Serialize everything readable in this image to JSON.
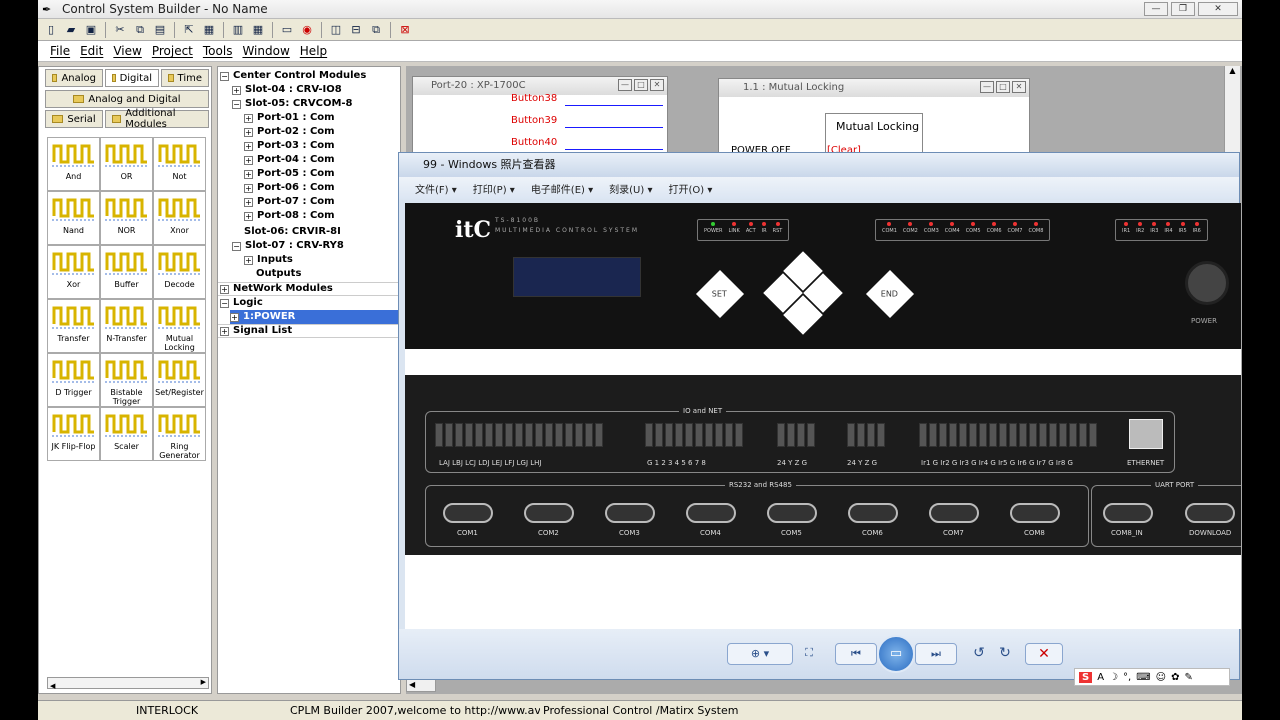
{
  "app": {
    "title": "Control System Builder - No Name",
    "menu": [
      "File",
      "Edit",
      "View",
      "Project",
      "Tools",
      "Window",
      "Help"
    ]
  },
  "left_panel": {
    "tabs_row1": [
      "Analog",
      "Digital",
      "Time"
    ],
    "tab_row2": "Analog and Digital",
    "tabs_row3": [
      "Serial",
      "Additional Modules"
    ],
    "modules": [
      "And",
      "OR",
      "Not",
      "Nand",
      "NOR",
      "Xnor",
      "Xor",
      "Buffer",
      "Decode",
      "Transfer",
      "N-Transfer",
      "Mutual Locking",
      "D Trigger",
      "Bistable Trigger",
      "Set/Register",
      "JK Flip-Flop",
      "Scaler",
      "Ring Generator"
    ]
  },
  "tree": {
    "center_control": "Center Control Modules",
    "slot04": "Slot-04 : CRV-IO8",
    "slot05": "Slot-05:  CRVCOM-8",
    "ports": [
      "Port-01 : Com",
      "Port-02 : Com",
      "Port-03 : Com",
      "Port-04 : Com",
      "Port-05 : Com",
      "Port-06 : Com",
      "Port-07 : Com",
      "Port-08 : Com"
    ],
    "slot06": "Slot-06:  CRVIR-8I",
    "slot07": "Slot-07 : CRV-RY8",
    "inputs": "Inputs",
    "outputs": "Outputs",
    "network": "NetWork Modules",
    "logic": "Logic",
    "logic_item": "1:POWER",
    "signal_list": "Signal List"
  },
  "mdi_port": {
    "title": "Port-20 : XP-1700C",
    "buttons": [
      "Button38",
      "Button39",
      "Button40"
    ]
  },
  "mdi_lock": {
    "title": "1.1 : Mutual Locking",
    "box_label": "Mutual Locking",
    "power_text": "POWER OFF",
    "clear_text": "[Clear]"
  },
  "photo_viewer": {
    "title": "99 - Windows 照片查看器",
    "menu": [
      "文件(F)",
      "打印(P)",
      "电子邮件(E)",
      "刻录(U)",
      "打开(O)"
    ]
  },
  "device": {
    "logo": "itC",
    "model": "TS-8100B",
    "subtitle": "MULTIMEDIA CONTROL SYSTEM",
    "leds_status": [
      "POWER",
      "LINK",
      "ACT",
      "IR",
      "RST"
    ],
    "leds_com": [
      "COM1",
      "COM2",
      "COM3",
      "COM4",
      "COM5",
      "COM6",
      "COM7",
      "COM8"
    ],
    "leds_ir": [
      "IR1",
      "IR2",
      "IR3",
      "IR4",
      "IR5",
      "IR6"
    ],
    "btn_set": "SET",
    "btn_end": "END",
    "power_label": "POWER",
    "io_group": "IO and NET",
    "relay_labels": "LAJ  LBJ  LCJ  LDJ  LEJ  LFJ  LGJ  LHJ",
    "io_labels": "G  1  2  3  4  5  6  7  8",
    "v24_labels": "24  Y  Z  G",
    "v24b_labels": "24  Y  Z  G",
    "ir_labels": "Ir1 G  Ir2 G  Ir3 G  Ir4 G  Ir5 G  Ir6 G  Ir7 G  Ir8 G",
    "ethernet": "ETHERNET",
    "rs_group": "RS232 and RS485",
    "com_ports": [
      "COM1",
      "COM2",
      "COM3",
      "COM4",
      "COM5",
      "COM6",
      "COM7",
      "COM8"
    ],
    "uart_group": "UART PORT",
    "uart_ports": [
      "COM8_IN",
      "DOWNLOAD"
    ]
  },
  "status": {
    "mode": "INTERLOCK",
    "message": "CPLM Builder 2007,welcome to http://www.avcit.con",
    "tagline": "Professional Control /Matirx System"
  }
}
